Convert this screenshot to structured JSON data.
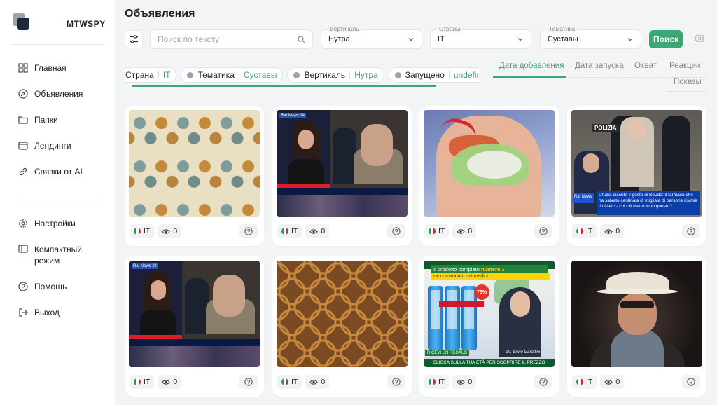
{
  "sidebar": {
    "brand": "MTWSPY",
    "nav_top": [
      {
        "label": "Главная",
        "icon": "grid-icon"
      },
      {
        "label": "Объявления",
        "icon": "compass-icon"
      },
      {
        "label": "Папки",
        "icon": "folder-icon"
      },
      {
        "label": "Лендинги",
        "icon": "window-icon"
      },
      {
        "label": "Связки от AI",
        "icon": "link-icon"
      }
    ],
    "nav_bottom": [
      {
        "label": "Настройки",
        "icon": "gear-icon"
      },
      {
        "label": "Компактный режим",
        "icon": "compact-icon"
      },
      {
        "label": "Помощь",
        "icon": "help-icon"
      },
      {
        "label": "Выход",
        "icon": "logout-icon"
      }
    ]
  },
  "header": {
    "title": "Объявления",
    "search_placeholder": "Поиск по тексту",
    "filters": [
      {
        "label": "Вертикаль",
        "value": "Нутра"
      },
      {
        "label": "Страны",
        "value": "IT"
      },
      {
        "label": "Тематика",
        "value": "Суставы"
      }
    ],
    "search_button": "Поиск"
  },
  "chips": [
    {
      "key": "Страна",
      "value": "IT"
    },
    {
      "key": "Тематика",
      "value": "Суставы"
    },
    {
      "key": "Вертикаль",
      "value": "Нутра"
    },
    {
      "key": "Запущено",
      "value": "undefined"
    }
  ],
  "sort_tabs": [
    "Дата добавления",
    "Дата запуска",
    "Охват",
    "Реакции",
    "Показы"
  ],
  "sort_active": "Дата добавления",
  "cards": [
    {
      "country": "IT",
      "views": "0",
      "art": "pattern-floral"
    },
    {
      "country": "IT",
      "views": "0",
      "art": "news"
    },
    {
      "country": "IT",
      "views": "0",
      "art": "shoulder"
    },
    {
      "country": "IT",
      "views": "0",
      "art": "police"
    },
    {
      "country": "IT",
      "views": "0",
      "art": "news"
    },
    {
      "country": "IT",
      "views": "0",
      "art": "pattern-quatrefoil"
    },
    {
      "country": "IT",
      "views": "0",
      "art": "promo"
    },
    {
      "country": "IT",
      "views": "0",
      "art": "singer"
    }
  ],
  "thumb_text": {
    "news_logo": "Rai News 24",
    "police_sign": "POLIZIA",
    "police_caption": "L'Italia discute il gesto di Baudo: il farmaco che ha salvato centinaia di migliaia di persone rischia il divieto - chi c'è dietro tutto questo?",
    "rai_logo": "Rai News",
    "promo_title_1": "Il prodotto completo ",
    "promo_title_2": "numero 1",
    "promo_sub": "raccomandato dai medici",
    "promo_badge": "75%",
    "promo_gift": "RICEVI UN REGALO",
    "promo_doctor": "Dr. Silvio Garattini",
    "promo_footer": "CLICCA SULLA TUA ETÀ PER SCOPRIRE IL PREZZO"
  },
  "colors": {
    "accent": "#3aa876",
    "flag_green": "#1f9e49",
    "flag_white": "#ffffff",
    "flag_red": "#d8232a"
  }
}
